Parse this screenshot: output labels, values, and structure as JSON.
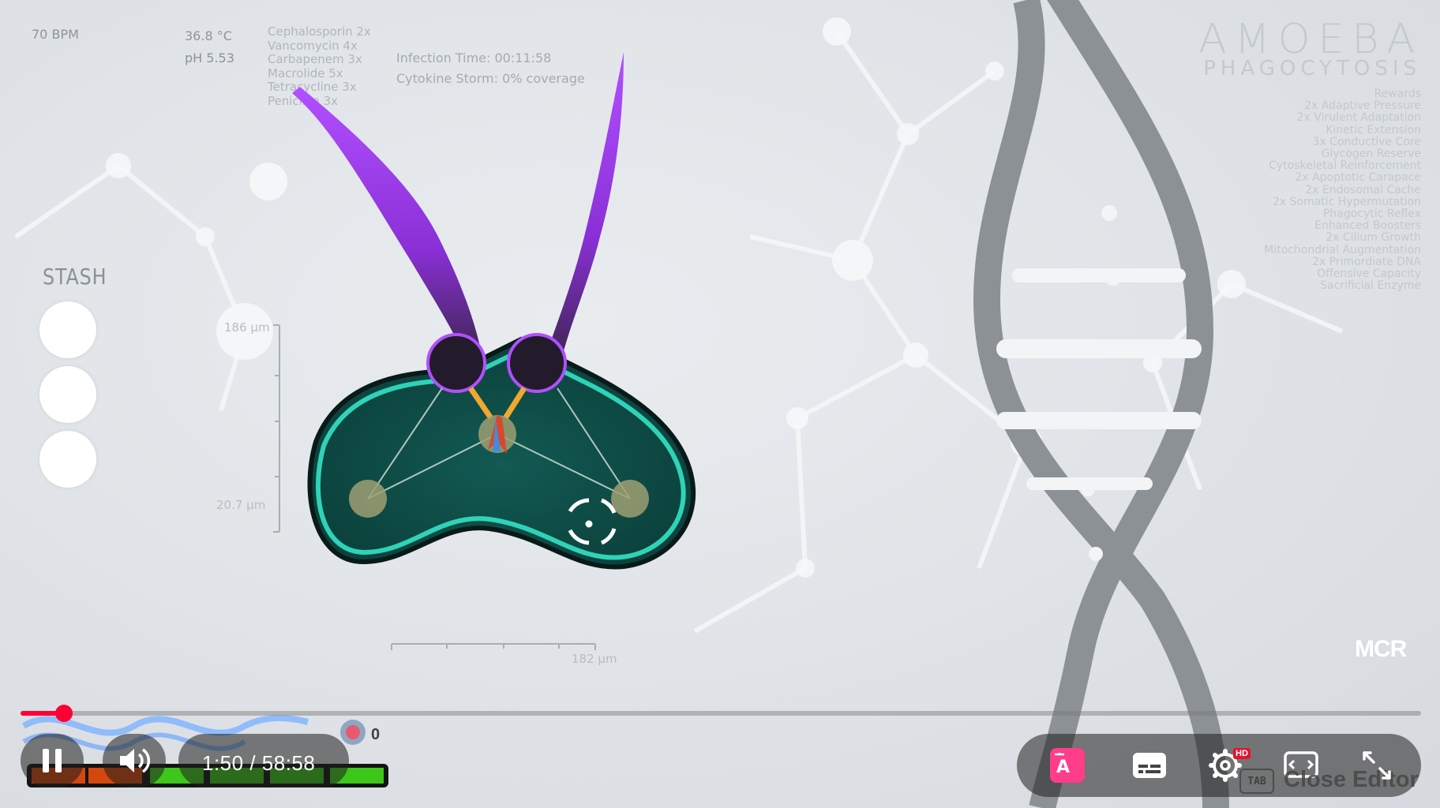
{
  "hud": {
    "heart_rate": "70 BPM",
    "temperature": "36.8 °C",
    "ph": "pH 5.53",
    "antibiotics": [
      "Cephalosporin 2x",
      "Vancomycin 4x",
      "Carbapenem 3x",
      "Macrolide 5x",
      "Tetracycline 3x",
      "Penicillin 3x"
    ],
    "infection_time": "Infection Time: 00:11:58",
    "cytokine_storm": "Cytokine Storm: 0% coverage"
  },
  "title": {
    "main": "AMOEBA",
    "sub": "PHAGOCYTOSIS"
  },
  "mods": {
    "header": "Rewards",
    "items": [
      "2x Adaptive Pressure",
      "2x Virulent Adaptation",
      "Kinetic Extension",
      "3x Conductive Core",
      "Glycogen Reserve",
      "Cytoskeletal Reinforcement",
      "2x Apoptotic Carapace",
      "2x Endosomal Cache",
      "2x Somatic Hypermutation",
      "Phagocytic Reflex",
      "Enhanced Boosters",
      "2x Cilium Growth",
      "Mitochondrial Augmentation",
      "2x Primordiate DNA",
      "Offensive Capacity",
      "Sacrificial Enzyme"
    ]
  },
  "stash": {
    "label": "STASH",
    "slots": 3
  },
  "scale": {
    "vertical_top": "186 µm",
    "vertical_bottom": "20.7 µm",
    "horizontal": "182 µm"
  },
  "logo": {
    "text": "MCR"
  },
  "player": {
    "time_display": "1:50 / 58:58",
    "progress_fraction": 0.031,
    "counter": "0",
    "tab_key": "TAB",
    "editor_label": "Close Editor",
    "hd_badge": "HD",
    "colors": {
      "accent": "#ff0033",
      "cell_fill": "#0d4a45",
      "cell_outline": "#2fd3b7",
      "tentacle": "#9b30e8"
    },
    "icons": [
      "pause-icon",
      "volume-icon",
      "auto-translate-icon",
      "subtitles-icon",
      "settings-icon",
      "theater-mode-icon",
      "fullscreen-exit-icon"
    ]
  }
}
